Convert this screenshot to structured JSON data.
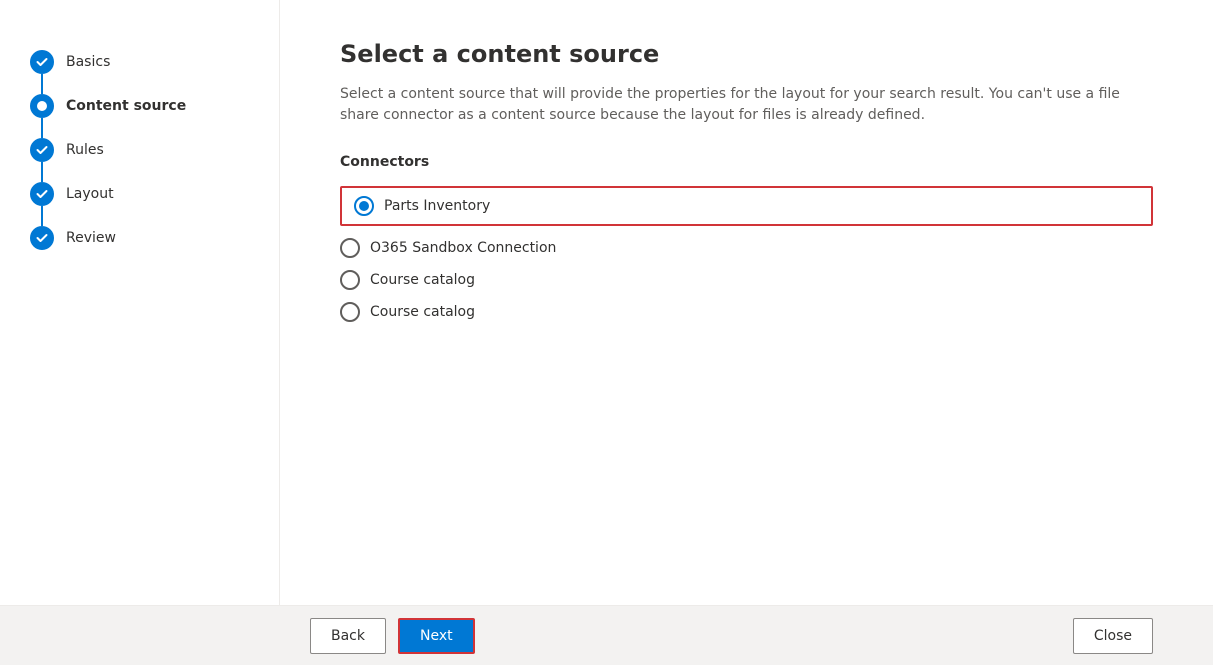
{
  "sidebar": {
    "steps": [
      {
        "id": "basics",
        "label": "Basics",
        "state": "completed"
      },
      {
        "id": "content-source",
        "label": "Content source",
        "state": "active"
      },
      {
        "id": "rules",
        "label": "Rules",
        "state": "completed"
      },
      {
        "id": "layout",
        "label": "Layout",
        "state": "completed"
      },
      {
        "id": "review",
        "label": "Review",
        "state": "completed"
      }
    ]
  },
  "main": {
    "title": "Select a content source",
    "description": "Select a content source that will provide the properties for the layout for your search result. You can't use a file share connector as a content source because the layout for files is already defined.",
    "connectors_label": "Connectors",
    "connectors": [
      {
        "id": "parts-inventory",
        "label": "Parts Inventory",
        "selected": true
      },
      {
        "id": "o365-sandbox",
        "label": "O365 Sandbox Connection",
        "selected": false
      },
      {
        "id": "course-catalog-1",
        "label": "Course catalog",
        "selected": false
      },
      {
        "id": "course-catalog-2",
        "label": "Course catalog",
        "selected": false
      }
    ]
  },
  "footer": {
    "back_label": "Back",
    "next_label": "Next",
    "close_label": "Close"
  }
}
